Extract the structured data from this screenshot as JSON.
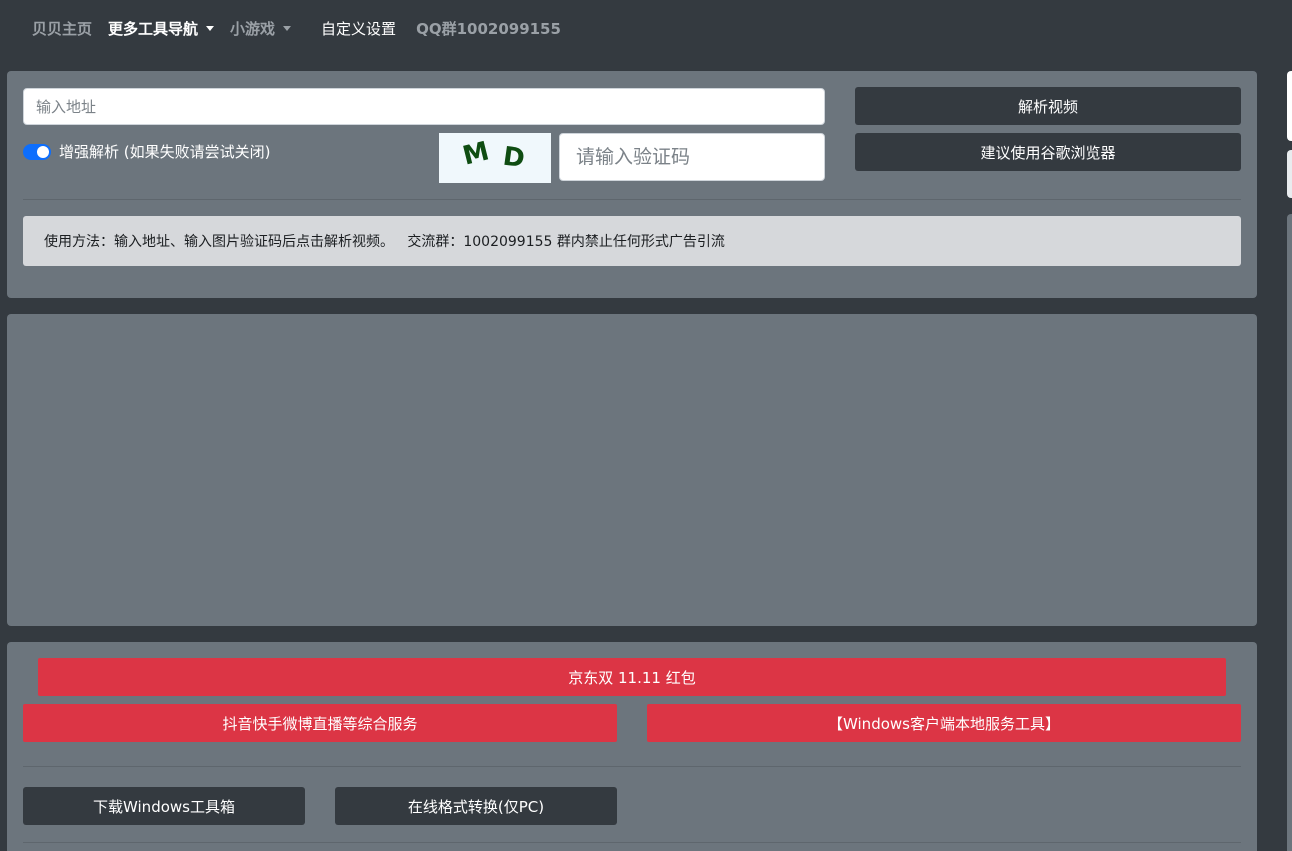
{
  "navbar": {
    "brand": "贝贝主页",
    "items": [
      {
        "label": "更多工具导航",
        "dropdown": true
      },
      {
        "label": "小游戏",
        "dropdown": true
      },
      {
        "label": "自定义设置"
      },
      {
        "label": "QQ群1002099155"
      }
    ]
  },
  "parser": {
    "url_placeholder": "输入地址",
    "enhanced_toggle_label": "增强解析 (如果失败请尝试关闭)",
    "enhanced_enabled": true,
    "captcha_text": [
      "M",
      "D"
    ],
    "captcha_placeholder": "请输入验证码",
    "parse_button": "解析视频",
    "browser_button": "建议使用谷歌浏览器",
    "notice": "使用方法：输入地址、输入图片验证码后点击解析视频。   交流群：1002099155 群内禁止任何形式广告引流"
  },
  "links": {
    "jd": "京东双 11.11 红包",
    "douyin": "抖音快手微博直播等综合服务",
    "windows_local": "【Windows客户端本地服务工具】",
    "download": "下载Windows工具箱",
    "convert": "在线格式转换(仅PC)"
  },
  "colors": {
    "background": "#343a40",
    "card": "#6c757d",
    "danger": "#dc3545",
    "primary": "#0d6efd"
  }
}
